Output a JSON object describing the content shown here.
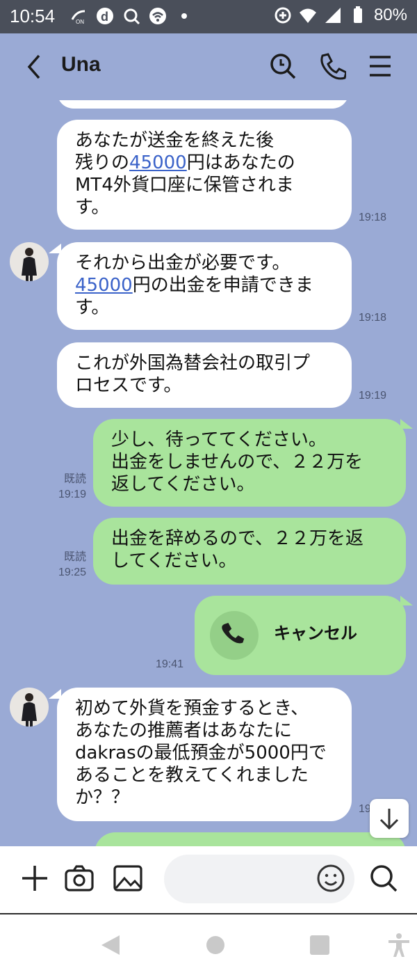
{
  "status_bar": {
    "time": "10:54",
    "battery": "80%"
  },
  "header": {
    "title": "Una"
  },
  "messages": [
    {
      "side": "in",
      "lines_html": [
        "あなたが送金を終えた後"
      ],
      "l1": "あなたが送金を終えた後",
      "l2a": "残りの",
      "l2link": "45000",
      "l2b": "円はあなたの",
      "l3": "MT4外貨口座に保管されま",
      "l4": "す。",
      "time": "19:18"
    },
    {
      "side": "in",
      "l1": "それから出金が必要です。",
      "l2link": "45000",
      "l2b": "円の出金を申請できま",
      "l3": "す。",
      "time": "19:18"
    },
    {
      "side": "in",
      "l1": "これが外国為替会社の取引プ",
      "l2": "ロセスです。",
      "time": "19:19"
    },
    {
      "side": "out",
      "l1": "少し、待っててください。",
      "l2": "出金をしませんので、２２万を",
      "l3": "返してください。",
      "read": "既読",
      "time": "19:19"
    },
    {
      "side": "out",
      "l1": "出金を辞めるので、２２万を返",
      "l2": "してください。",
      "read": "既読",
      "time": "19:25"
    },
    {
      "side": "out",
      "call_label": "キャンセル",
      "time": "19:41"
    },
    {
      "side": "in",
      "l1": "初めて外貨を預金するとき、",
      "l2": "あなたの推薦者はあなたに",
      "l3": "dakrasの最低預金が5000円で",
      "l4": "あることを教えてくれました",
      "l5": "か？？",
      "time": "19"
    }
  ],
  "input": {
    "placeholder": ""
  },
  "colors": {
    "chat_bg": "#9aaad5",
    "incoming": "#ffffff",
    "outgoing": "#a9e49c",
    "status_bar": "#4a4f5a",
    "link": "#3a62c9"
  },
  "icons": [
    "back-icon",
    "search-icon",
    "phone-icon",
    "menu-icon",
    "plus-icon",
    "camera-icon",
    "image-icon",
    "emoji-icon",
    "scroll-down-icon",
    "nav-back-icon",
    "nav-home-icon",
    "nav-recents-icon",
    "accessibility-icon"
  ]
}
